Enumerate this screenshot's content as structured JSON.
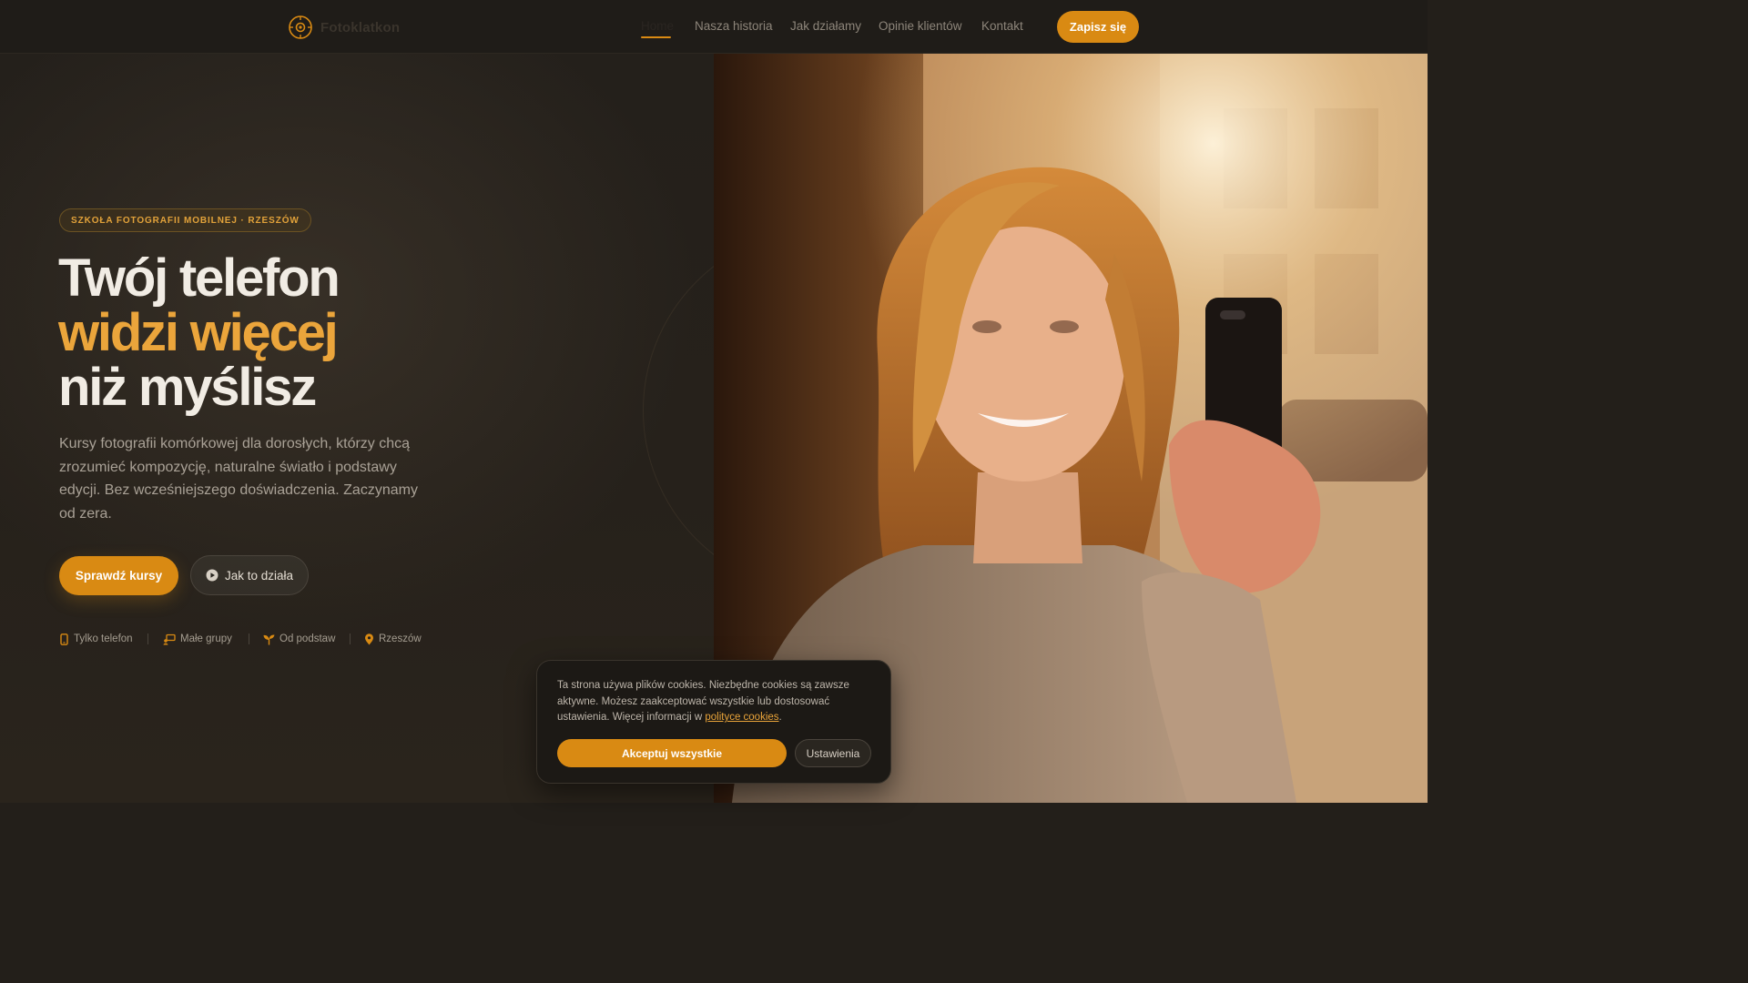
{
  "nav": {
    "brand": "Fotoklatkon",
    "links": [
      "Home",
      "Nasza historia",
      "Jak działamy",
      "Opinie klientów",
      "Kontakt"
    ],
    "active_index": 0,
    "cta": "Zapisz się"
  },
  "hero": {
    "badge": "SZKOŁA FOTOGRAFII MOBILNEJ · RZESZÓW",
    "title_line1": "Twój telefon",
    "title_line2": "widzi więcej",
    "title_line3": "niż myślisz",
    "lead": "Kursy fotografii komórkowej dla dorosłych, którzy chcą zrozumieć kompozycję, naturalne światło i podstawy edycji. Bez wcześniejszego doświadczenia. Zaczynamy od zera.",
    "primary_button": "Sprawdź kursy",
    "secondary_button": "Jak to działa",
    "features": [
      {
        "label": "Tylko telefon",
        "icon": "phone-icon"
      },
      {
        "label": "Małe grupy",
        "icon": "group-icon"
      },
      {
        "label": "Od podstaw",
        "icon": "sprout-icon"
      },
      {
        "label": "Rzeszów",
        "icon": "map-pin-icon"
      }
    ]
  },
  "cookie": {
    "text": "Ta strona używa plików cookies. Niezbędne cookies są zawsze aktywne. Możesz zaakceptować wszystkie lub dostosować ustawienia. Więcej informacji w",
    "link": "polityce cookies",
    "text_end": ".",
    "accept_button": "Akceptuj wszystkie",
    "settings_button": "Ustawienia"
  },
  "colors": {
    "accent": "#d98a13",
    "accent_text": "#eba53b",
    "background": "#231f1a",
    "heading": "#f1ece4"
  }
}
